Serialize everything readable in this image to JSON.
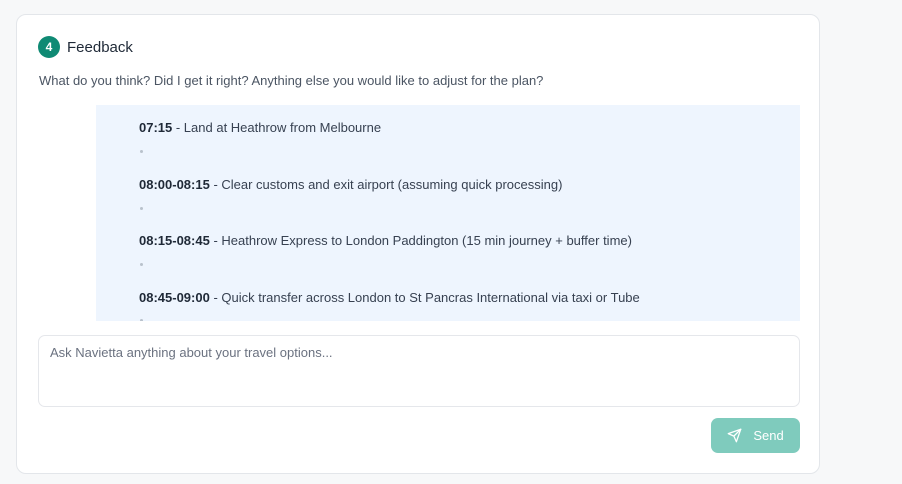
{
  "feedback": {
    "step_number": "4",
    "title": "Feedback",
    "prompt": "What do you think? Did I get it right? Anything else you would like to adjust for the plan?"
  },
  "plan": {
    "items": [
      {
        "time": "07:15",
        "text": " - Land at Heathrow from Melbourne"
      },
      {
        "time": "08:00-08:15",
        "text": " - Clear customs and exit airport (assuming quick processing)"
      },
      {
        "time": "08:15-08:45",
        "text": " - Heathrow Express to London Paddington (15 min journey + buffer time)"
      },
      {
        "time": "08:45-09:00",
        "text": " - Quick transfer across London to St Pancras International via taxi or Tube"
      }
    ]
  },
  "chat": {
    "placeholder": "Ask Navietta anything about your travel options...",
    "value": "",
    "send_label": "Send",
    "send_icon": "send-icon"
  },
  "colors": {
    "accent": "#0f8a74",
    "send_button_bg": "#7fcbbd",
    "plan_bg": "#eef5fe"
  }
}
